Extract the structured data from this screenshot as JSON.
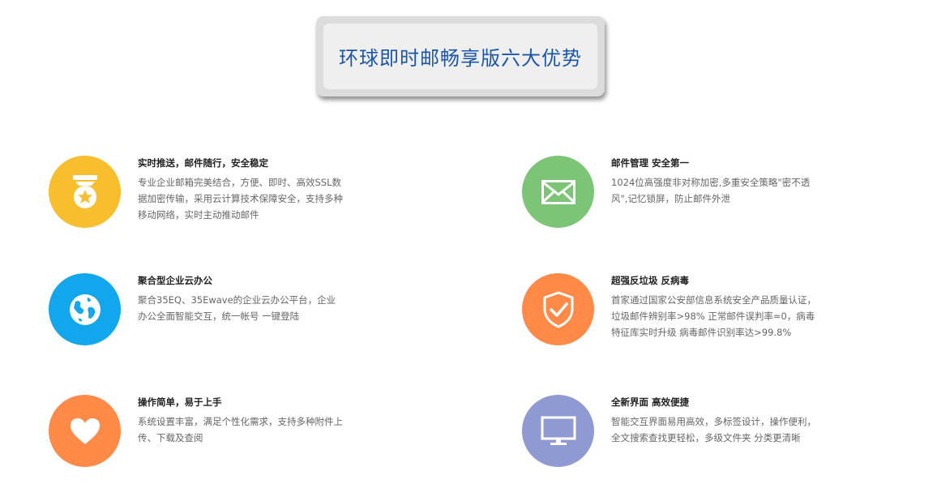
{
  "header": {
    "title": "环球即时邮畅享版六大优势"
  },
  "features": [
    {
      "title": "实时推送，邮件随行，安全稳定",
      "desc": "专业企业邮箱完美结合，方便、即时、高效SSL数据加密传输，采用云计算技术保障安全，支持多种移动网络，实时主动推动邮件",
      "icon": "medal-icon",
      "color": "#f9be2d"
    },
    {
      "title": "邮件管理 安全第一",
      "desc": "1024位高强度非对称加密,多重安全策略\"密不透风\",记忆锁屏，防止邮件外泄",
      "icon": "envelope-icon",
      "color": "#7cc576"
    },
    {
      "title": "聚合型企业云办公",
      "desc": "聚合35EQ、35Ewave的企业云办公平台，企业办公全面智能交互，统一帐号 一键登陆",
      "icon": "globe-icon",
      "color": "#12a7ec"
    },
    {
      "title": "超强反垃圾 反病毒",
      "desc": "首家通过国家公安部信息系统安全产品质量认证，垃圾邮件辨别率>98% 正常邮件误判率≈0，病毒特征库实时升级 病毒邮件识别率达>99.8%",
      "icon": "shield-check-icon",
      "color": "#ff8a47"
    },
    {
      "title": "操作简单，易于上手",
      "desc": "系统设置丰富，满足个性化需求，支持多种附件上传、下载及查阅",
      "icon": "heart-icon",
      "color": "#ff8a47"
    },
    {
      "title": "全新界面 高效便捷",
      "desc": "智能交互界面易用高效，多标签设计，操作便利，全文搜索查找更轻松，多级文件夹 分类更清晰",
      "icon": "monitor-icon",
      "color": "#8f99d2"
    }
  ]
}
